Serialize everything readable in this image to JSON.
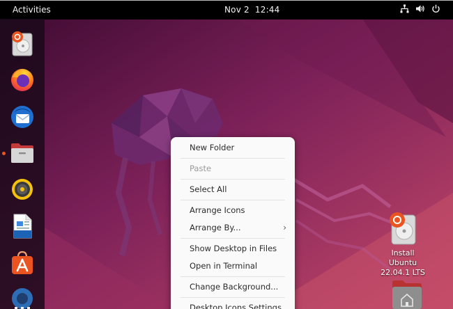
{
  "topbar": {
    "activities": "Activities",
    "date": "Nov 2",
    "time": "12:44",
    "tray_icons": [
      "network-icon",
      "volume-icon",
      "power-icon"
    ]
  },
  "dock": {
    "items": [
      {
        "name": "installer",
        "icon": "ubuntu-installer-icon"
      },
      {
        "name": "firefox",
        "icon": "firefox-icon"
      },
      {
        "name": "thunderbird",
        "icon": "thunderbird-icon"
      },
      {
        "name": "files",
        "icon": "files-icon"
      },
      {
        "name": "rhythmbox",
        "icon": "rhythmbox-icon"
      },
      {
        "name": "writer",
        "icon": "libreoffice-writer-icon"
      },
      {
        "name": "software",
        "icon": "software-icon"
      },
      {
        "name": "help",
        "icon": "help-icon"
      },
      {
        "name": "show-apps",
        "icon": "app-grid-icon"
      }
    ],
    "running_indicator": "#e95420"
  },
  "context_menu": {
    "new_folder": "New Folder",
    "paste": "Paste",
    "select_all": "Select All",
    "arrange_icons": "Arrange Icons",
    "arrange_by": "Arrange By...",
    "show_desktop_in_files": "Show Desktop in Files",
    "open_in_terminal": "Open in Terminal",
    "change_background": "Change Background...",
    "desktop_icons_settings": "Desktop Icons Settings"
  },
  "desktop_icons": {
    "install_ubuntu": {
      "line1": "Install Ubuntu",
      "line2": "22.04.1 LTS"
    },
    "home": {
      "label": ""
    }
  },
  "colors": {
    "accent": "#e95420",
    "wallpaper_dark": "#4a0f3a",
    "wallpaper_mid": "#8e2a63",
    "wallpaper_light": "#c4476b"
  }
}
